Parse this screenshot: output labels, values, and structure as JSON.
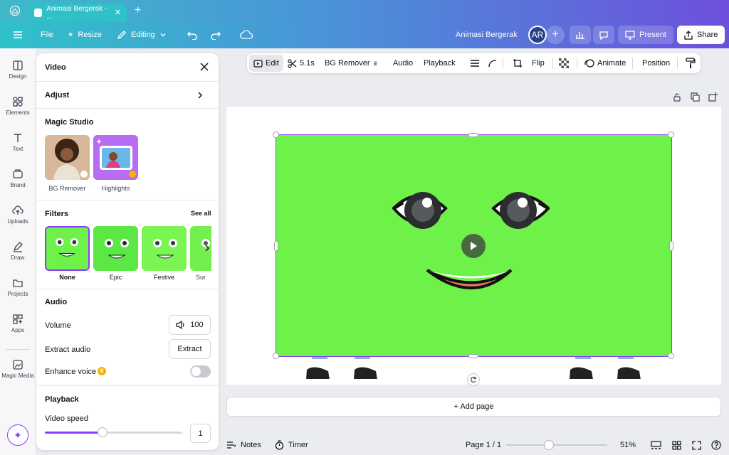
{
  "browser": {
    "tab_title": "Animasi Bergerak - ...",
    "new_tab": "+"
  },
  "topbar": {
    "file": "File",
    "resize": "Resize",
    "editing": "Editing",
    "project_title": "Animasi Bergerak",
    "avatar_initials": "AR",
    "present": "Present",
    "share": "Share"
  },
  "rail": {
    "items": [
      {
        "label": "Design"
      },
      {
        "label": "Elements"
      },
      {
        "label": "Text"
      },
      {
        "label": "Brand"
      },
      {
        "label": "Uploads"
      },
      {
        "label": "Draw"
      },
      {
        "label": "Projects"
      },
      {
        "label": "Apps"
      },
      {
        "label": "Magic Media"
      }
    ]
  },
  "panel": {
    "title": "Video",
    "adjust": "Adjust",
    "magic_studio": {
      "heading": "Magic Studio",
      "items": [
        {
          "label": "BG Remover"
        },
        {
          "label": "Highlights"
        }
      ]
    },
    "filters": {
      "heading": "Filters",
      "see_all": "See all",
      "items": [
        {
          "label": "None"
        },
        {
          "label": "Epic"
        },
        {
          "label": "Festive"
        },
        {
          "label": "Sur"
        }
      ]
    },
    "audio": {
      "heading": "Audio",
      "volume_label": "Volume",
      "volume_value": "100",
      "extract_label": "Extract audio",
      "extract_button": "Extract",
      "enhance_label": "Enhance voice",
      "enhance_on": false
    },
    "playback": {
      "heading": "Playback",
      "speed_label": "Video speed",
      "speed_value": "1",
      "speed_fraction": 0.42
    }
  },
  "context_toolbar": {
    "edit": "Edit",
    "duration": "5.1s",
    "bg_remover": "BG Remover",
    "audio": "Audio",
    "playback": "Playback",
    "flip": "Flip",
    "animate": "Animate",
    "position": "Position"
  },
  "canvas": {
    "add_page": "+ Add page",
    "background_color": "#6ef24a"
  },
  "bottombar": {
    "notes": "Notes",
    "timer": "Timer",
    "page_indicator": "Page 1 / 1",
    "zoom": "51%",
    "zoom_fraction": 0.42
  },
  "colors": {
    "accent": "#8b3dff",
    "brand_teal": "#2fc2c9"
  }
}
